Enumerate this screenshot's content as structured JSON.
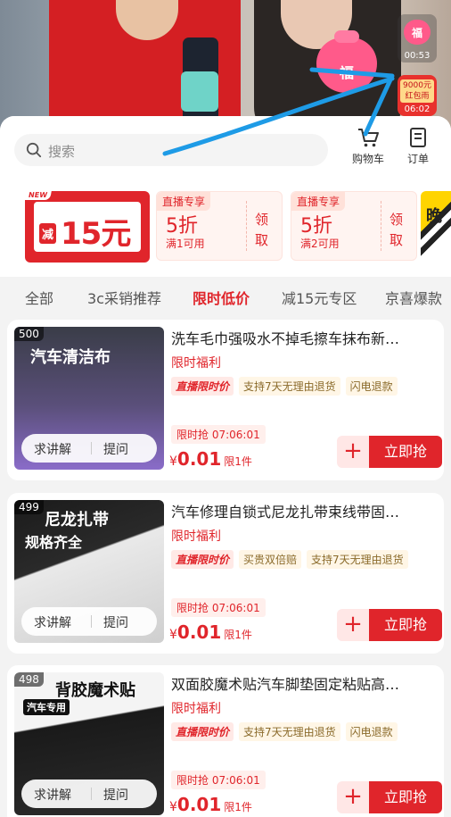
{
  "live": {
    "fu_char": "福",
    "widget_time": "00:53",
    "redpack_amount": "9000元红包雨",
    "redpack_time": "06:02"
  },
  "search": {
    "placeholder": "搜索"
  },
  "topbar": {
    "cart_label": "购物车",
    "order_label": "订单"
  },
  "coupons": {
    "main": {
      "new_tag": "NEW",
      "prefix": "减",
      "amount": "15元"
    },
    "cards": [
      {
        "tag": "直播专享",
        "discount": "5折",
        "condition": "满1可用",
        "claim": "领取"
      },
      {
        "tag": "直播专享",
        "discount": "5折",
        "condition": "满2可用",
        "claim": "领取"
      }
    ],
    "peek_text": "晚"
  },
  "tabs": [
    {
      "label": "全部",
      "active": false
    },
    {
      "label": "3c采销推荐",
      "active": false
    },
    {
      "label": "限时低价",
      "active": true
    },
    {
      "label": "减15元专区",
      "active": false
    },
    {
      "label": "京喜爆款",
      "active": false
    }
  ],
  "products": [
    {
      "rank": "500",
      "thumb_title": "汽车清洁布",
      "thumb_sub": "",
      "title": "洗车毛巾强吸水不掉毛擦车抹布新…",
      "welfare": "限时福利",
      "tags": [
        "直播限时价",
        "支持7天无理由退货",
        "闪电退款"
      ],
      "flash": "限时抢 07:06:01",
      "price_currency": "¥",
      "price": "0.01",
      "price_from": "限1件",
      "ask_explain": "求讲解",
      "ask_question": "提问",
      "buy": "立即抢",
      "thumb_color": "#4a4a52"
    },
    {
      "rank": "499",
      "thumb_title": "尼龙扎带",
      "thumb_sub": "规格齐全",
      "title": "汽车修理自锁式尼龙扎带束线带固…",
      "welfare": "限时福利",
      "tags": [
        "直播限时价",
        "买贵双倍赔",
        "支持7天无理由退货"
      ],
      "flash": "限时抢 07:06:01",
      "price_currency": "¥",
      "price": "0.01",
      "price_from": "限1件",
      "ask_explain": "求讲解",
      "ask_question": "提问",
      "buy": "立即抢",
      "thumb_color": "#1e1e1e"
    },
    {
      "rank": "498",
      "thumb_title": "背胶魔术贴",
      "thumb_sub": "汽车专用",
      "title": "双面胶魔术贴汽车脚垫固定粘贴高…",
      "welfare": "限时福利",
      "tags": [
        "直播限时价",
        "支持7天无理由退货",
        "闪电退款"
      ],
      "flash": "限时抢 07:06:01",
      "price_currency": "¥",
      "price": "0.01",
      "price_from": "限1件",
      "ask_explain": "求讲解",
      "ask_question": "提问",
      "buy": "立即抢",
      "thumb_color": "#f2f2f2"
    }
  ]
}
